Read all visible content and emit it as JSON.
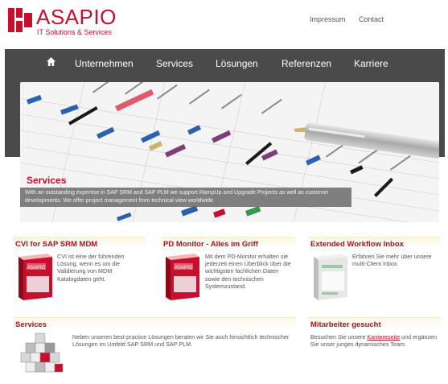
{
  "header": {
    "logo_name": "ASAPIO",
    "logo_sub": "IT Solutions & Services",
    "links": [
      "Impressum",
      "Contact"
    ]
  },
  "nav": {
    "home_icon": "home-icon",
    "items": [
      "Unternehmen",
      "Services",
      "Lösungen",
      "Referenzen",
      "Karriere"
    ]
  },
  "banner": {
    "title": "Services",
    "text": "With an outstanding expertise in SAP SRM and SAP PLM we support RampUp and Upgrade Projects as well as customer developments. We offer project management from technical view worldwide."
  },
  "features": [
    {
      "title": "CVI for SAP SRM MDM",
      "text": "CVI ist eine der führenden Lösung, wenn es um die Validierung von MDM Katalogdaten geht."
    },
    {
      "title": "PD Monitor - Alles im Griff",
      "text": "Mit dem PD-Monitor erhalten sie jederzeit einen Überblick über die wichtigsten fachlichen Daten sowie den technischen Systemzustand."
    },
    {
      "title": "Extended Workflow Inbox",
      "text": "Erfahren Sie mehr über unsere multi-Client Inbox."
    },
    {
      "title": "Services",
      "text": "Neben unseren best-practice Lösungen beraten wir Sie auch hinsichtlich technischer Lösungen im Umfeld SAP SRM und SAP PLM."
    },
    {
      "title": "Mitarbeiter gesucht",
      "text_before": "Besuchen Sie unsere ",
      "link": "Karriereseite",
      "text_after": " und ergänzen Sie unser junges dynamisches Team."
    }
  ],
  "colors": {
    "brand_red": "#c8102e",
    "nav_gray": "#4a4a4a"
  }
}
